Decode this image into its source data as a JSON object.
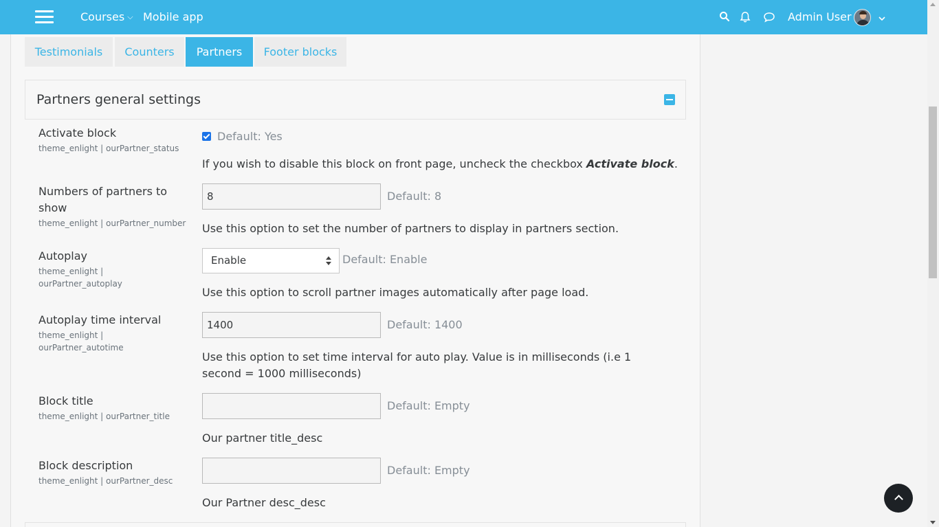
{
  "navbar": {
    "menu_icon": "hamburger-icon",
    "courses_label": "Courses",
    "mobile_app_label": "Mobile app",
    "user_name": "Admin User",
    "icons": [
      "search-icon",
      "bell-icon",
      "chat-icon"
    ]
  },
  "tabs": [
    {
      "label": "Testimonials",
      "active": false
    },
    {
      "label": "Counters",
      "active": false
    },
    {
      "label": "Partners",
      "active": true
    },
    {
      "label": "Footer blocks",
      "active": false
    }
  ],
  "section": {
    "title": "Partners general settings"
  },
  "settings": {
    "activate_block": {
      "label": "Activate block",
      "key": "theme_enlight | ourPartner_status",
      "checked": true,
      "default": "Default: Yes",
      "desc_prefix": "If you wish to disable this block on front page, uncheck the checkbox ",
      "desc_emph": "Activate block",
      "desc_suffix": "."
    },
    "partners_number": {
      "label": "Numbers of partners to show",
      "key": "theme_enlight | ourPartner_number",
      "value": "8",
      "default": "Default: 8",
      "desc": "Use this option to set the number of partners to display in partners section."
    },
    "autoplay": {
      "label": "Autoplay",
      "key": "theme_enlight | ourPartner_autoplay",
      "selected": "Enable",
      "default": "Default: Enable",
      "desc": "Use this option to scroll partner images automatically after page load."
    },
    "autoplay_time": {
      "label": "Autoplay time interval",
      "key": "theme_enlight | ourPartner_autotime",
      "value": "1400",
      "default": "Default: 1400",
      "desc": "Use this option to set time interval for auto play. Value is in milliseconds (i.e 1 second = 1000 milliseconds)"
    },
    "block_title": {
      "label": "Block title",
      "key": "theme_enlight | ourPartner_title",
      "value": "",
      "default": "Default: Empty",
      "desc": "Our partner title_desc"
    },
    "block_description": {
      "label": "Block description",
      "key": "theme_enlight | ourPartner_desc",
      "value": "",
      "default": "Default: Empty",
      "desc": "Our Partner desc_desc"
    }
  },
  "colors": {
    "brand": "#3bb5e6",
    "text": "#373a3c",
    "muted": "#868e96"
  }
}
